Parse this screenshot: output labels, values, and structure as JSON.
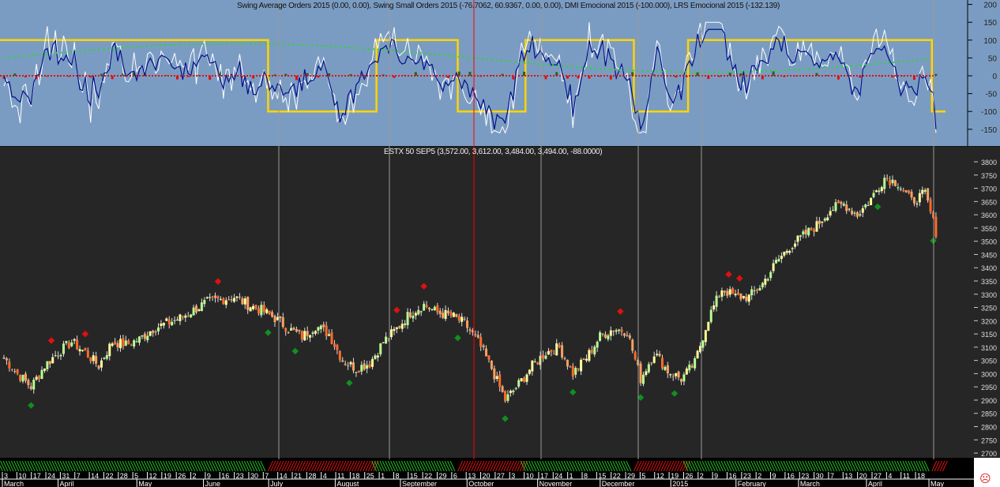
{
  "indicator_pane": {
    "title": "Swing Average Orders 2015 (0.00, 0.00), Swing Small Orders 2015 (-76.7062, 60.9367, 0.00, 0.00), DMI Emocional 2015 (-100.000), LRS Emocional 2015 (-132.139)",
    "axis_labels": [
      "200",
      "150",
      "100",
      "50",
      "0",
      "-50",
      "-100",
      "-150"
    ]
  },
  "price_pane": {
    "title": "ESTX 50 SEP5 (3,572.00, 3,612.00, 3,484.00, 3,494.00, -88.0000)",
    "axis_labels": [
      "3800",
      "3750",
      "3700",
      "3650",
      "3600",
      "3550",
      "3500",
      "3450",
      "3400",
      "3350",
      "3300",
      "3250",
      "3200",
      "3150",
      "3100",
      "3050",
      "3000",
      "2950",
      "2900",
      "2850",
      "2800",
      "2750",
      "2700"
    ]
  },
  "chart_data": {
    "type": "candlestick",
    "ylim": [
      2700,
      3800
    ],
    "weekly_closes": [
      3060,
      3000,
      2950,
      3030,
      3080,
      3120,
      3080,
      3030,
      3120,
      3110,
      3130,
      3170,
      3190,
      3210,
      3240,
      3270,
      3280,
      3290,
      3260,
      3240,
      3210,
      3170,
      3140,
      3180,
      3150,
      3050,
      3020,
      3040,
      3120,
      3170,
      3230,
      3260,
      3230,
      3220,
      3190,
      3120,
      3020,
      2900,
      2960,
      3030,
      3080,
      3100,
      3000,
      3060,
      3140,
      3170,
      3160,
      2980,
      3080,
      3010,
      2980,
      3040,
      3210,
      3320,
      3290,
      3290,
      3340,
      3420,
      3480,
      3520,
      3560,
      3620,
      3640,
      3600,
      3660,
      3740,
      3720,
      3650,
      3680,
      3500
    ],
    "regime": [
      1,
      1,
      1,
      1,
      1,
      1,
      1,
      1,
      1,
      1,
      1,
      1,
      1,
      1,
      1,
      1,
      1,
      1,
      1,
      1,
      -1,
      -1,
      -1,
      -1,
      -1,
      -1,
      -1,
      -1,
      1,
      1,
      1,
      1,
      1,
      1,
      -1,
      -1,
      -1,
      -1,
      -1,
      1,
      1,
      1,
      1,
      1,
      1,
      1,
      1,
      -1,
      -1,
      -1,
      -1,
      1,
      1,
      1,
      1,
      1,
      1,
      1,
      1,
      1,
      1,
      1,
      1,
      1,
      1,
      1,
      1,
      1,
      1,
      -1
    ],
    "markers": [
      {
        "w": 3.5,
        "t": "sell"
      },
      {
        "w": 6,
        "t": "sell"
      },
      {
        "w": 2,
        "t": "buy"
      },
      {
        "w": 15.8,
        "t": "sell"
      },
      {
        "w": 19.5,
        "t": "buy"
      },
      {
        "w": 21.5,
        "t": "buy"
      },
      {
        "w": 25.5,
        "t": "buy"
      },
      {
        "w": 29,
        "t": "sell"
      },
      {
        "w": 31,
        "t": "sell"
      },
      {
        "w": 33.5,
        "t": "buy"
      },
      {
        "w": 37,
        "t": "buy"
      },
      {
        "w": 42,
        "t": "buy"
      },
      {
        "w": 45.5,
        "t": "sell"
      },
      {
        "w": 47,
        "t": "buy"
      },
      {
        "w": 49.5,
        "t": "buy"
      },
      {
        "w": 53.5,
        "t": "sell"
      },
      {
        "w": 54.3,
        "t": "sell"
      },
      {
        "w": 64.5,
        "t": "buy"
      },
      {
        "w": 68.6,
        "t": "buy"
      }
    ]
  },
  "timeline": {
    "days": [
      "3",
      "10",
      "17",
      "24",
      "31",
      "7",
      "14",
      "22",
      "28",
      "5",
      "12",
      "19",
      "26",
      "2",
      "9",
      "16",
      "23",
      "30",
      "7",
      "14",
      "21",
      "28",
      "4",
      "11",
      "18",
      "25",
      "1",
      "8",
      "15",
      "22",
      "29",
      "6",
      "13",
      "20",
      "27",
      "3",
      "10",
      "17",
      "24",
      "1",
      "8",
      "15",
      "22",
      "29",
      "5",
      "12",
      "19",
      "26",
      "2",
      "9",
      "16",
      "23",
      "2",
      "9",
      "16",
      "23",
      "30",
      "7",
      "13",
      "20",
      "27",
      "4",
      "11",
      "18"
    ],
    "months": [
      {
        "label": "March",
        "w": 0
      },
      {
        "label": "April",
        "w": 4.1
      },
      {
        "label": "May",
        "w": 9.9
      },
      {
        "label": "June",
        "w": 14.8
      },
      {
        "label": "July",
        "w": 19.6
      },
      {
        "label": "August",
        "w": 24.5
      },
      {
        "label": "September",
        "w": 29.3
      },
      {
        "label": "October",
        "w": 34.2
      },
      {
        "label": "November",
        "w": 39.4
      },
      {
        "label": "December",
        "w": 44
      },
      {
        "label": "2015",
        "w": 49.2
      },
      {
        "label": "February",
        "w": 54
      },
      {
        "label": "March",
        "w": 58.6
      },
      {
        "label": "April",
        "w": 63.6
      },
      {
        "label": "May",
        "w": 68.2
      }
    ]
  },
  "status_icon": "sad-face-icon",
  "colors": {
    "up": "#ffff99",
    "up2": "#b8ff90",
    "down": "#ffa060",
    "down2": "#ff6a2a",
    "yellow": "#ffd400"
  }
}
